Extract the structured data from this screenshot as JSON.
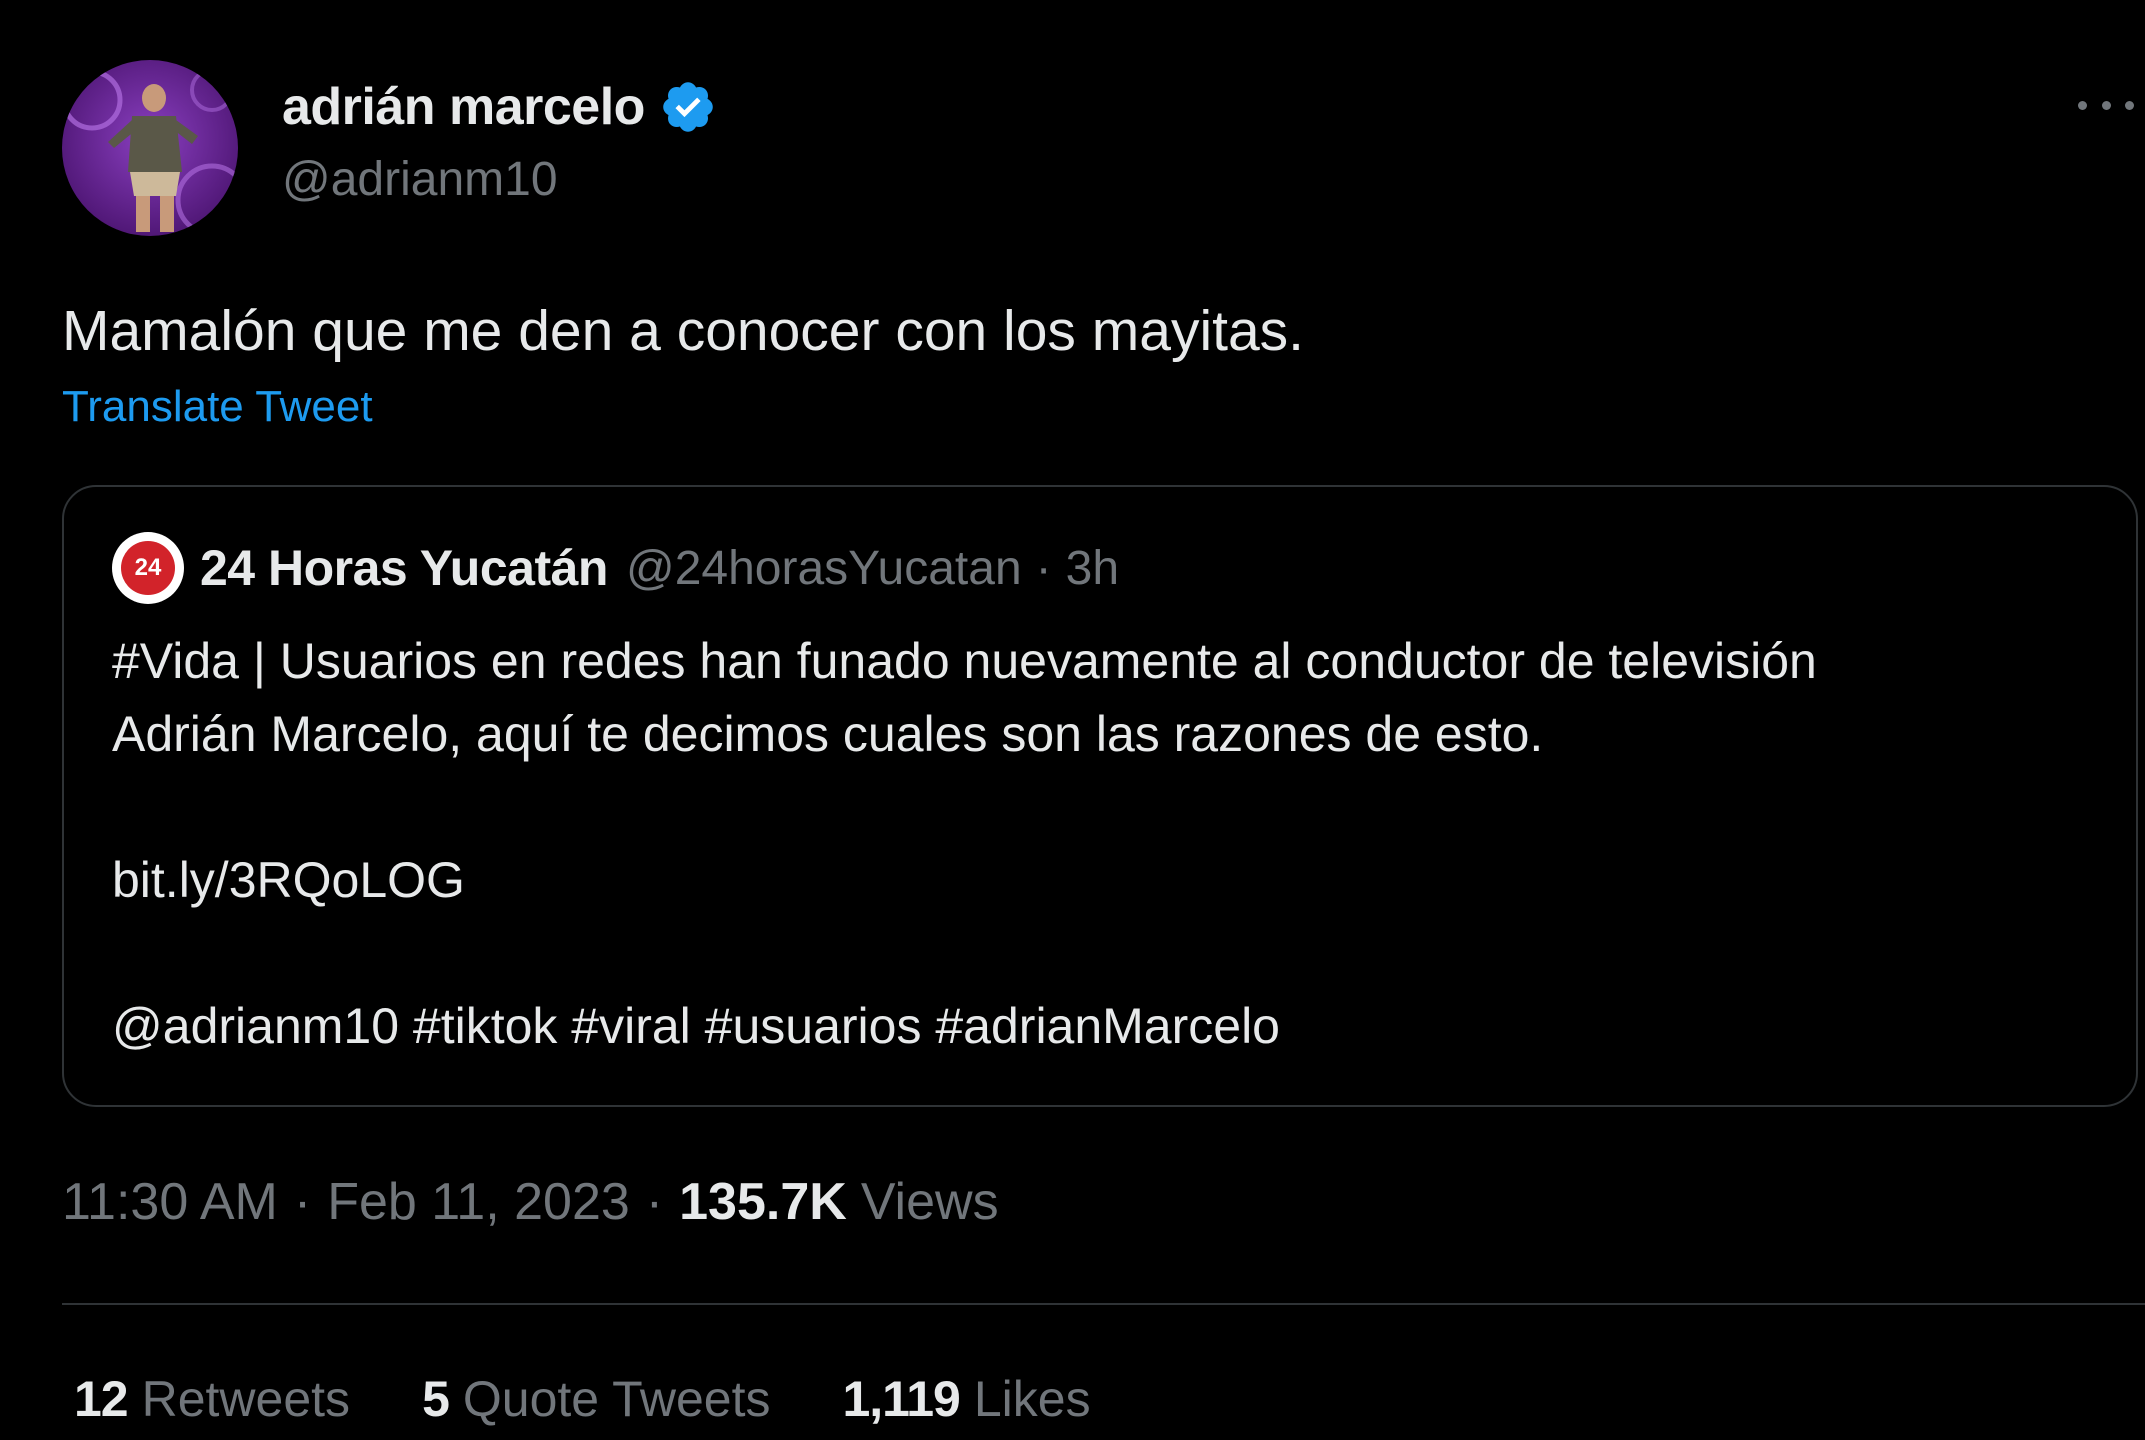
{
  "tweet": {
    "author": {
      "name": "adrián marcelo",
      "handle": "@adrianm10",
      "verified": true
    },
    "text": "Mamalón que me den a conocer con los mayitas.",
    "translate_label": "Translate Tweet",
    "quoted": {
      "name": "24 Horas Yucatán",
      "handle": "@24horasYucatan",
      "separator": "·",
      "time": "3h",
      "avatar_text": "24",
      "lines": [
        "#Vida | Usuarios en redes han funado nuevamente al conductor de televisión",
        "Adrián Marcelo, aquí te decimos cuales son las razones de esto.",
        "bit.ly/3RQoLOG",
        "@adrianm10 #tiktok #viral #usuarios #adrianMarcelo"
      ]
    },
    "timestamp": {
      "time": "11:30 AM",
      "separator": "·",
      "date": "Feb 11, 2023",
      "views_count": "135.7K",
      "views_label": "Views"
    },
    "stats": {
      "retweets_count": "12",
      "retweets_label": "Retweets",
      "quotes_count": "5",
      "quotes_label": "Quote Tweets",
      "likes_count": "1,119",
      "likes_label": "Likes"
    }
  },
  "colors": {
    "background": "#000000",
    "text_primary": "#e7e9ea",
    "text_secondary": "#71767b",
    "accent_blue": "#1d9bf0",
    "border": "#2f3336",
    "avatar_purple": "#6a2c91"
  },
  "icons": {
    "verified": "verified-badge-icon",
    "more": "more-options-icon"
  }
}
